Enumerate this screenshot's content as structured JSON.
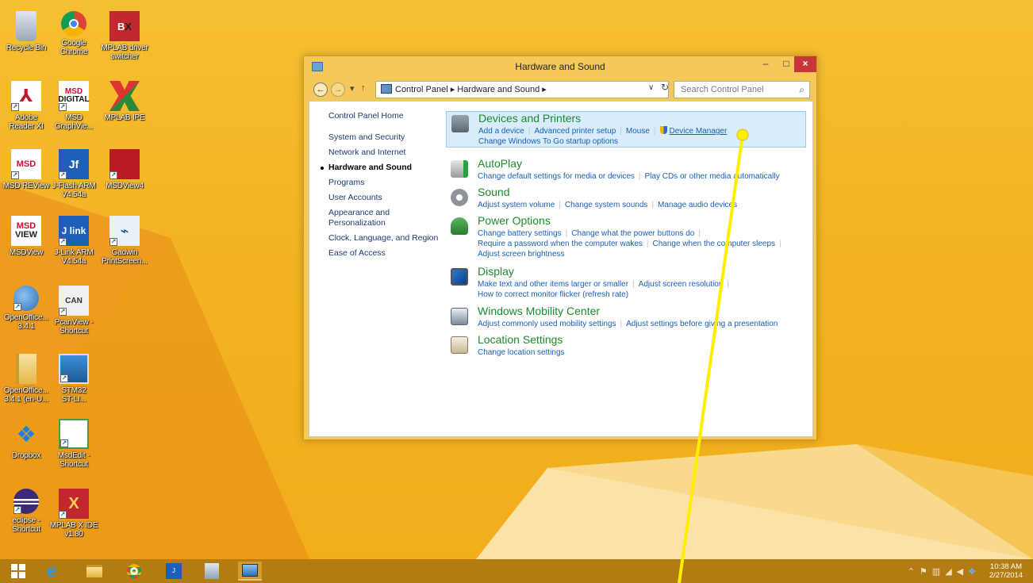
{
  "desktop": {
    "icons": [
      {
        "label": "Recycle Bin",
        "icon": "recycle-bin-icon"
      },
      {
        "label": "Google\nChrome",
        "icon": "chrome-icon"
      },
      {
        "label": "MPLAB driver\nswitcher",
        "icon": "mplab-driver-switcher-icon"
      },
      {
        "label": "Adobe\nReader XI",
        "icon": "adobe-reader-icon"
      },
      {
        "label": "MSD\nGraphVie...",
        "icon": "msd-graphview-icon"
      },
      {
        "label": "MPLAB IPE",
        "icon": "mplab-ipe-icon"
      },
      {
        "label": "MSD REView",
        "icon": "msd-review-icon"
      },
      {
        "label": "J-Flash ARM\nV4.54a",
        "icon": "jflash-arm-icon"
      },
      {
        "label": "MSDView4",
        "icon": "msdview4-icon"
      },
      {
        "label": "MSDView",
        "icon": "msdview-icon"
      },
      {
        "label": "J-Link ARM\nV4.54a",
        "icon": "jlink-arm-icon"
      },
      {
        "label": "Gadwin\nPrintScreen...",
        "icon": "gadwin-printscreen-icon"
      },
      {
        "label": "OpenOffice...\n3.4.1",
        "icon": "openoffice-icon"
      },
      {
        "label": "PcanView -\nShortcut",
        "icon": "pcanview-icon"
      },
      {
        "label": "OpenOffice...\n3.4.1 (en-U...",
        "icon": "openoffice-folder-icon"
      },
      {
        "label": "STM32\nST-LI...",
        "icon": "stm32-stlink-icon"
      },
      {
        "label": "Dropbox",
        "icon": "dropbox-icon"
      },
      {
        "label": "MsdEdit -\nShortcut",
        "icon": "msdedit-icon"
      },
      {
        "label": "eclipse -\nShortcut",
        "icon": "eclipse-icon"
      },
      {
        "label": "MPLAB X IDE\nv1.80",
        "icon": "mplab-x-ide-icon"
      }
    ]
  },
  "window": {
    "title": "Hardware and Sound",
    "minimize": "–",
    "maximize": "□",
    "close": "×",
    "address": {
      "back": "←",
      "forward": "→",
      "recent": "▾",
      "up": "↑",
      "path": "Control Panel ▸ Hardware and Sound ▸",
      "dropdown": "∨",
      "refresh": "↻"
    },
    "search": {
      "placeholder": "Search Control Panel",
      "icon": "⌕"
    },
    "left_nav": [
      "Control Panel Home",
      "System and Security",
      "Network and Internet",
      "Hardware and Sound",
      "Programs",
      "User Accounts",
      "Appearance and Personalization",
      "Clock, Language, and Region",
      "Ease of Access"
    ],
    "categories": {
      "devices": {
        "title": "Devices and Printers",
        "links": [
          "Add a device",
          "Advanced printer setup",
          "Mouse",
          "Device Manager",
          "Change Windows To Go startup options"
        ]
      },
      "autoplay": {
        "title": "AutoPlay",
        "links": [
          "Change default settings for media or devices",
          "Play CDs or other media automatically"
        ]
      },
      "sound": {
        "title": "Sound",
        "links": [
          "Adjust system volume",
          "Change system sounds",
          "Manage audio devices"
        ]
      },
      "power": {
        "title": "Power Options",
        "links": [
          "Change battery settings",
          "Change what the power buttons do",
          "Require a password when the computer wakes",
          "Change when the computer sleeps",
          "Adjust screen brightness"
        ]
      },
      "display": {
        "title": "Display",
        "links": [
          "Make text and other items larger or smaller",
          "Adjust screen resolution",
          "How to correct monitor flicker (refresh rate)"
        ]
      },
      "mobility": {
        "title": "Windows Mobility Center",
        "links": [
          "Adjust commonly used mobility settings",
          "Adjust settings before giving a presentation"
        ]
      },
      "location": {
        "title": "Location Settings",
        "links": [
          "Change location settings"
        ]
      }
    }
  },
  "taskbar": {
    "items": [
      "start-icon",
      "internet-explorer-icon",
      "file-explorer-icon",
      "chrome-icon",
      "jlink-server-icon",
      "app-icon",
      "control-panel-icon"
    ],
    "clock": {
      "time": "10:38 AM",
      "date": "2/27/2014"
    }
  },
  "colors": {
    "accent": "#f2b21d",
    "link": "#1a5fb4",
    "category_title": "#1e8a2e",
    "annotation": "#ffee00"
  }
}
